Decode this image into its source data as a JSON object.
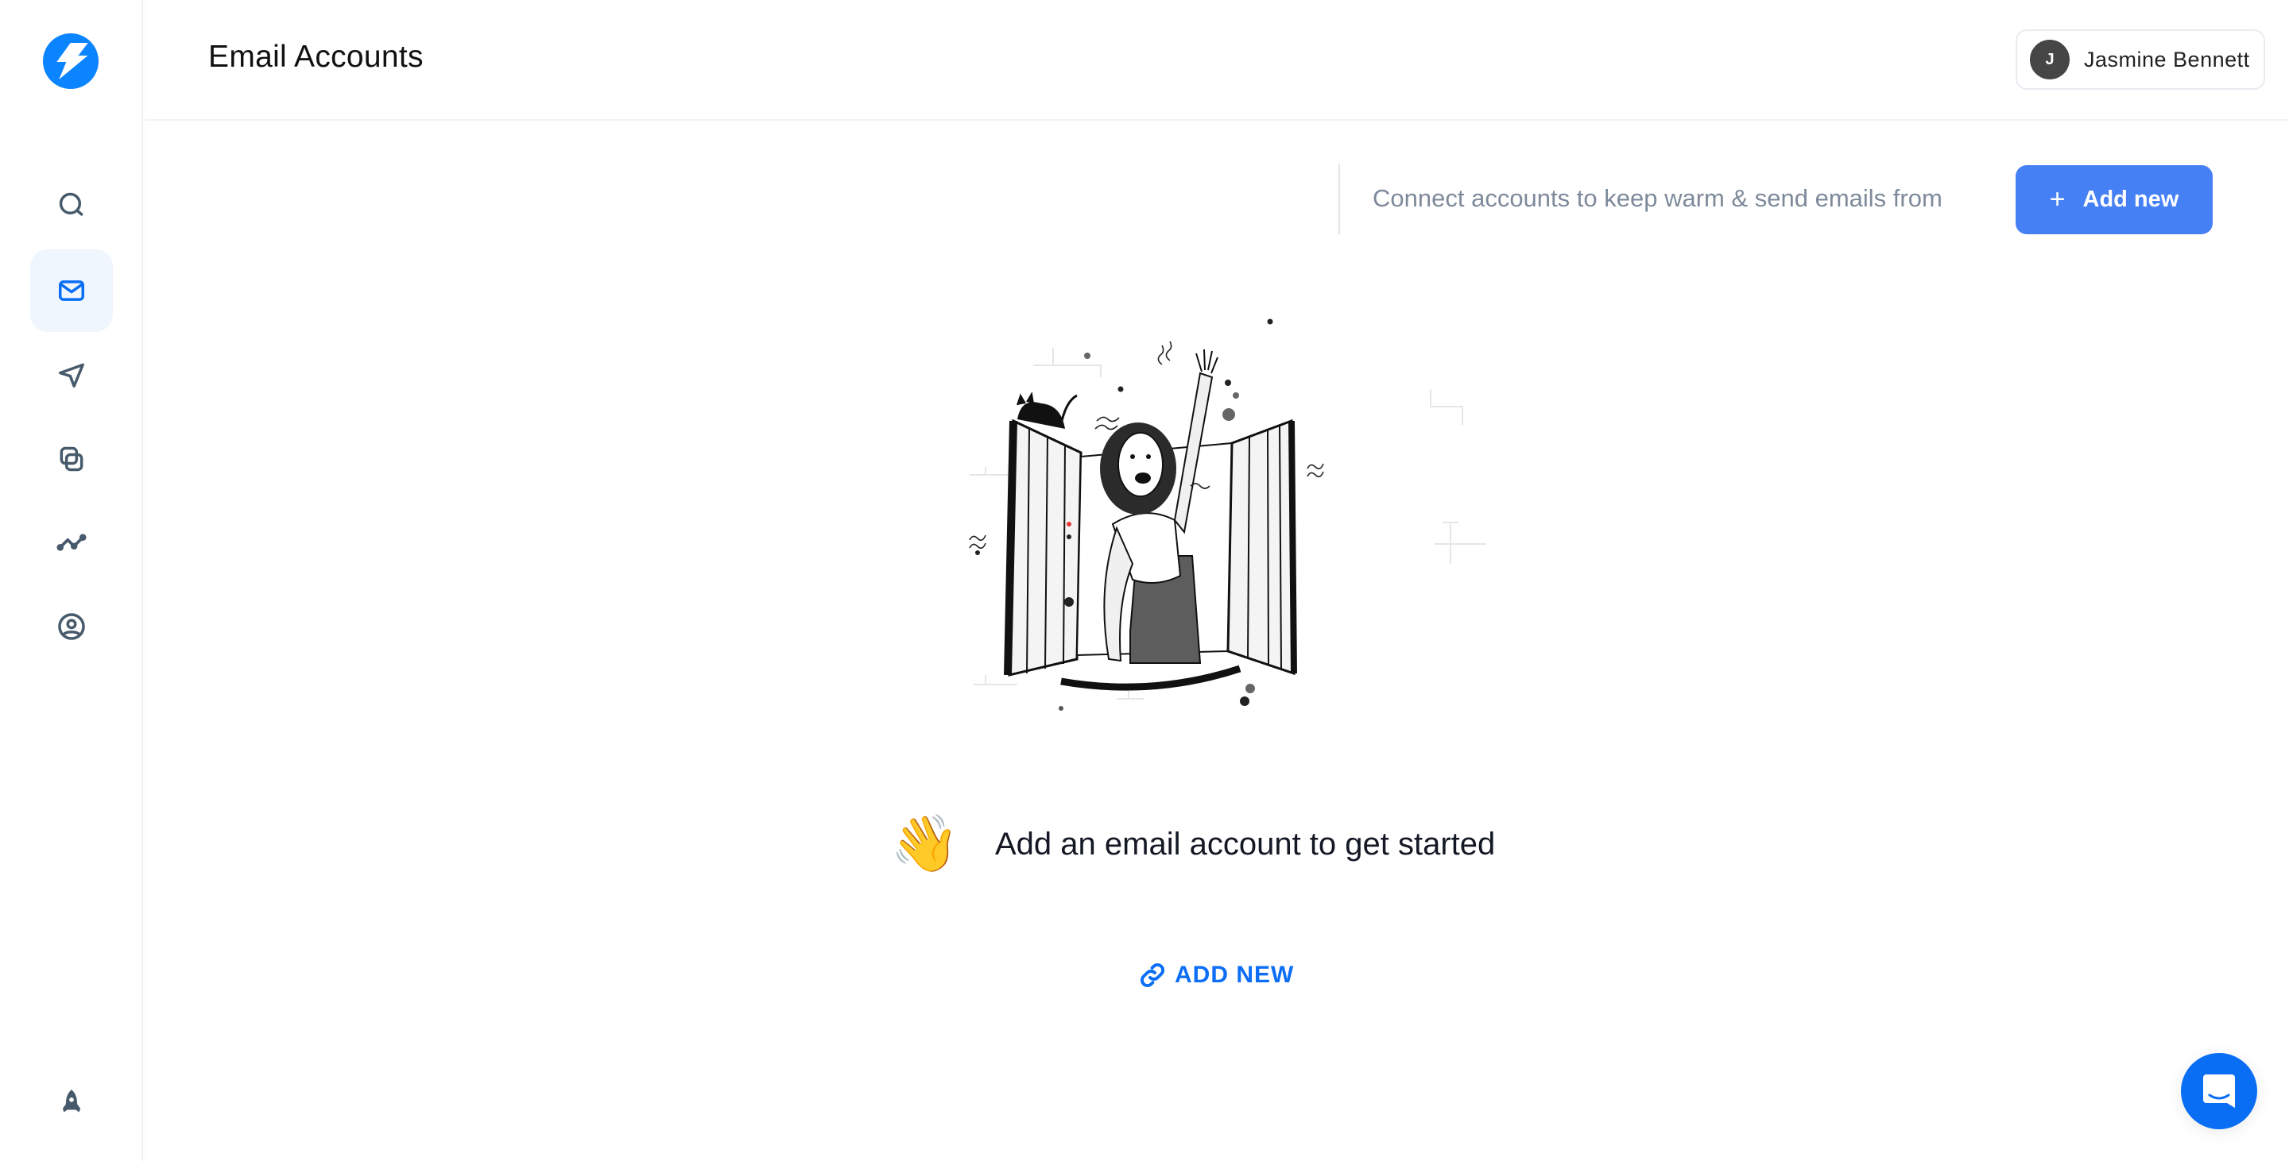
{
  "app": {
    "brand_color": "#0a84ff",
    "logo_icon": "lightning-bolt-icon"
  },
  "sidebar": {
    "items": [
      {
        "name": "search",
        "icon": "search-icon",
        "active": false
      },
      {
        "name": "email-accounts",
        "icon": "mail-icon",
        "active": true
      },
      {
        "name": "campaigns",
        "icon": "send-icon",
        "active": false
      },
      {
        "name": "templates",
        "icon": "copy-icon",
        "active": false
      },
      {
        "name": "analytics",
        "icon": "chart-line-icon",
        "active": false
      },
      {
        "name": "account",
        "icon": "user-circle-icon",
        "active": false
      }
    ],
    "bottom_item": {
      "name": "whats-new",
      "icon": "rocket-icon"
    }
  },
  "header": {
    "title": "Email Accounts",
    "user": {
      "initial": "J",
      "name": "Jasmine Bennett"
    }
  },
  "toolbar": {
    "hint": "Connect accounts to keep warm & send emails from",
    "add_button_icon": "+",
    "add_button_label": "Add new",
    "accent_color": "#4680f5"
  },
  "empty_state": {
    "emoji": "👋",
    "heading": "Add an email account to get started",
    "link_label": "ADD NEW",
    "link_icon": "link-icon",
    "link_color": "#0b6ef5"
  },
  "chat": {
    "icon": "chat-bubble-icon"
  }
}
